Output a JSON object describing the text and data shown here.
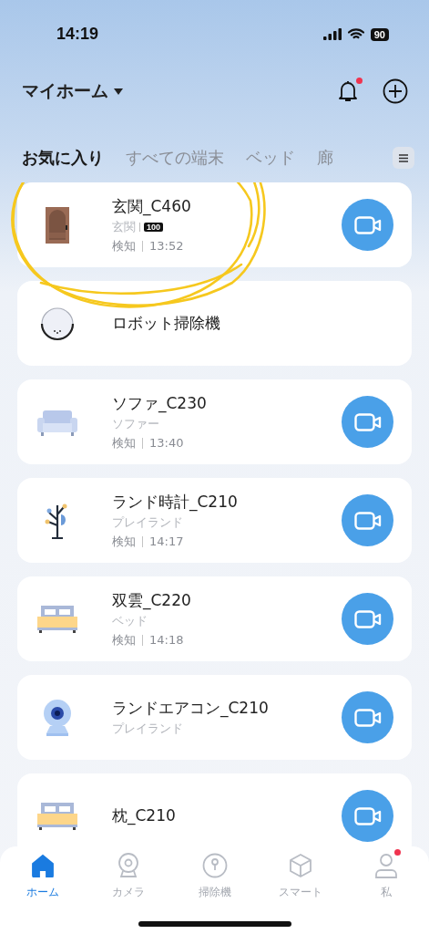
{
  "status_bar": {
    "time": "14:19",
    "battery": "90"
  },
  "header": {
    "title": "マイホーム",
    "notification_dot": true
  },
  "tabs": [
    {
      "label": "お気に入り",
      "selected": true
    },
    {
      "label": "すべての端末",
      "selected": false
    },
    {
      "label": "ベッド",
      "selected": false
    },
    {
      "label": "廊",
      "selected": false
    }
  ],
  "devices": [
    {
      "name": "玄関_C460",
      "kind": "door",
      "room": "玄関",
      "badge": "100",
      "detection_label": "検知",
      "detection_time": "13:52",
      "camera_button": true
    },
    {
      "name": "ロボット掃除機",
      "kind": "robot",
      "camera_button": false
    },
    {
      "name": "ソファ_C230",
      "kind": "sofa",
      "room": "ソファー",
      "detection_label": "検知",
      "detection_time": "13:40",
      "camera_button": true
    },
    {
      "name": "ランド時計_C210",
      "kind": "tree",
      "room": "プレイランド",
      "detection_label": "検知",
      "detection_time": "14:17",
      "camera_button": true
    },
    {
      "name": "双雲_C220",
      "kind": "bed",
      "room": "ベッド",
      "detection_label": "検知",
      "detection_time": "14:18",
      "camera_button": true
    },
    {
      "name": "ランドエアコン_C210",
      "kind": "webcam",
      "room": "プレイランド",
      "camera_button": true
    },
    {
      "name": "枕_C210",
      "kind": "bed",
      "camera_button": true
    }
  ],
  "bottom_nav": [
    {
      "label": "ホーム",
      "kind": "home",
      "selected": true,
      "dot": false
    },
    {
      "label": "カメラ",
      "kind": "camera",
      "selected": false,
      "dot": false
    },
    {
      "label": "掃除機",
      "kind": "vacuum",
      "selected": false,
      "dot": false
    },
    {
      "label": "スマート",
      "kind": "cube",
      "selected": false,
      "dot": false
    },
    {
      "label": "私",
      "kind": "person",
      "selected": false,
      "dot": true
    }
  ],
  "annotation": {
    "kind": "scribble"
  }
}
